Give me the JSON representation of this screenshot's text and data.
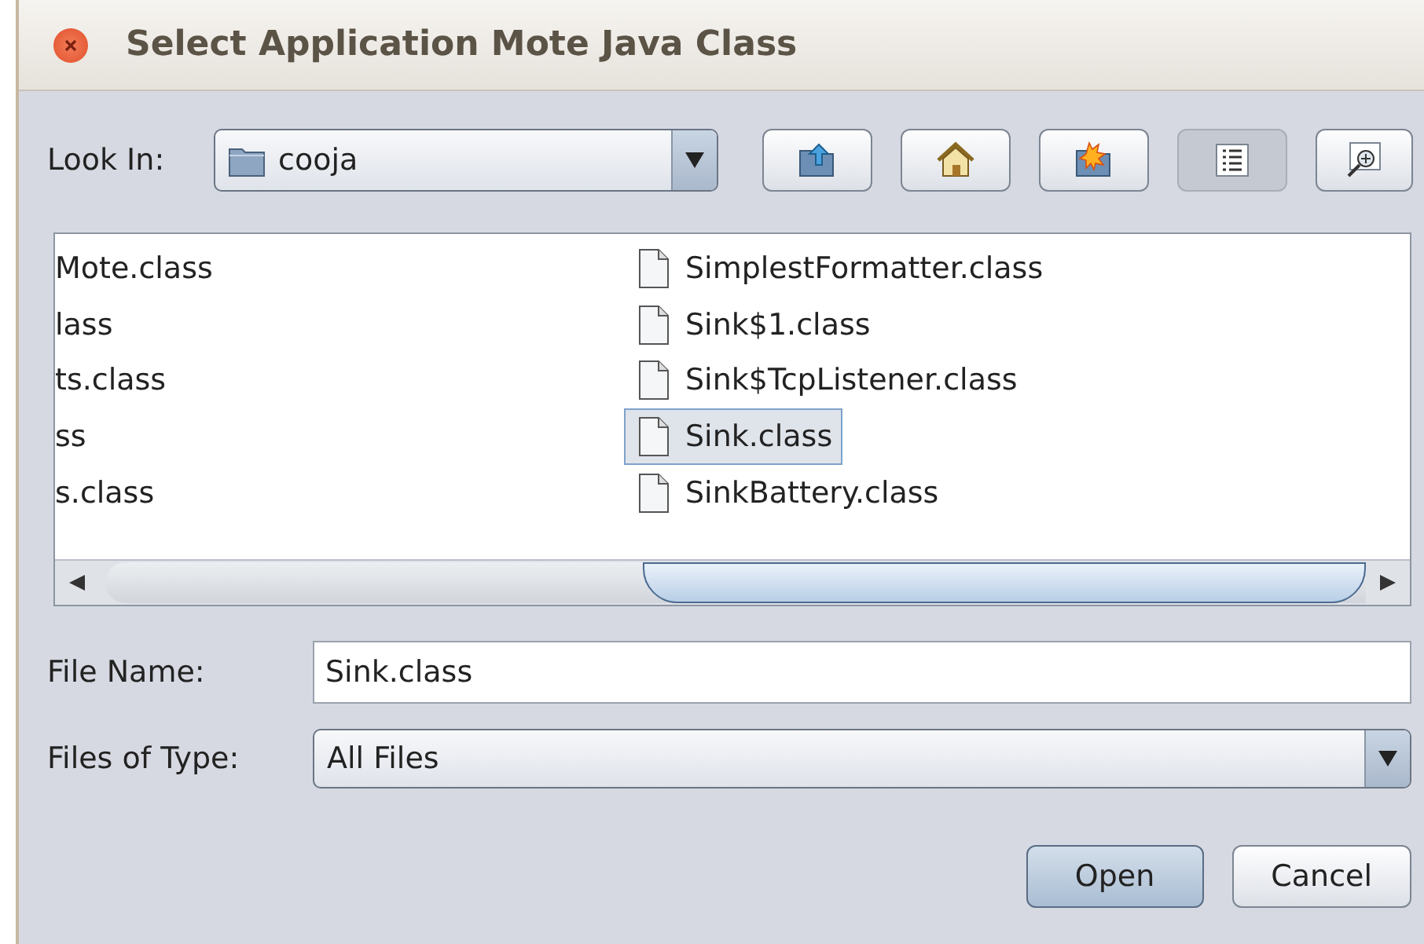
{
  "window": {
    "title": "Select Application Mote Java Class"
  },
  "look_in": {
    "label": "Look In:",
    "value": "cooja"
  },
  "toolbar": [
    {
      "kind": "up",
      "selected": false
    },
    {
      "kind": "home",
      "selected": false
    },
    {
      "kind": "newfolder",
      "selected": false
    },
    {
      "kind": "list",
      "selected": true
    },
    {
      "kind": "details",
      "selected": false
    }
  ],
  "files": {
    "columns": [
      [
        {
          "name": "Mote.class",
          "selected": false
        },
        {
          "name": "lass",
          "selected": false
        },
        {
          "name": "ts.class",
          "selected": false
        },
        {
          "name": "ss",
          "selected": false
        },
        {
          "name": "s.class",
          "selected": false
        }
      ],
      [
        {
          "name": "SimplestFormatter.class",
          "selected": false
        },
        {
          "name": "Sink$1.class",
          "selected": false
        },
        {
          "name": "Sink$TcpListener.class",
          "selected": false
        },
        {
          "name": "Sink.class",
          "selected": true
        },
        {
          "name": "SinkBattery.class",
          "selected": false
        }
      ]
    ]
  },
  "file_name": {
    "label": "File Name:",
    "value": "Sink.class"
  },
  "file_type": {
    "label": "Files of Type:",
    "value": "All Files"
  },
  "buttons": [
    {
      "label": "Open",
      "kind": "default"
    },
    {
      "label": "Cancel",
      "kind": "normal"
    }
  ]
}
